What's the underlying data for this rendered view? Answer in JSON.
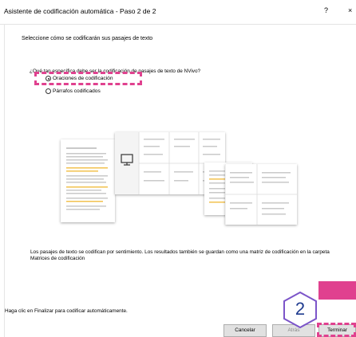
{
  "window": {
    "title": "Asistente de codificación automática - Paso 2 de 2",
    "help_glyph": "?",
    "close_glyph": "×"
  },
  "instruction": "Seleccione cómo se codificarán sus pasajes de texto",
  "question": "¿Qué tan específica debe ser la codificación de pasajes de texto de NVivo?",
  "options": [
    {
      "label": "Oraciones de codificación",
      "selected": true
    },
    {
      "label": "Párrafos codificados",
      "selected": false
    }
  ],
  "description": "Los pasajes de texto se codifican por sentimiento. Los resultados también se guardan como una matriz de codificación en la carpeta Matrices de codificación",
  "footer_text": "Haga clic en Finalizar para codificar automáticamente.",
  "buttons": {
    "cancel": "Cancelar",
    "back": "Atrás",
    "finish": "Terminar"
  },
  "step_badge": "2",
  "colors": {
    "highlight": "#e0418f",
    "badge_number": "#1f3b8f",
    "badge_border": "#7c55c9",
    "text_line": "#c9c9c9",
    "text_highlight": "#f2c14e"
  },
  "icons": [
    "help-icon",
    "close-icon",
    "monitor-icon"
  ]
}
